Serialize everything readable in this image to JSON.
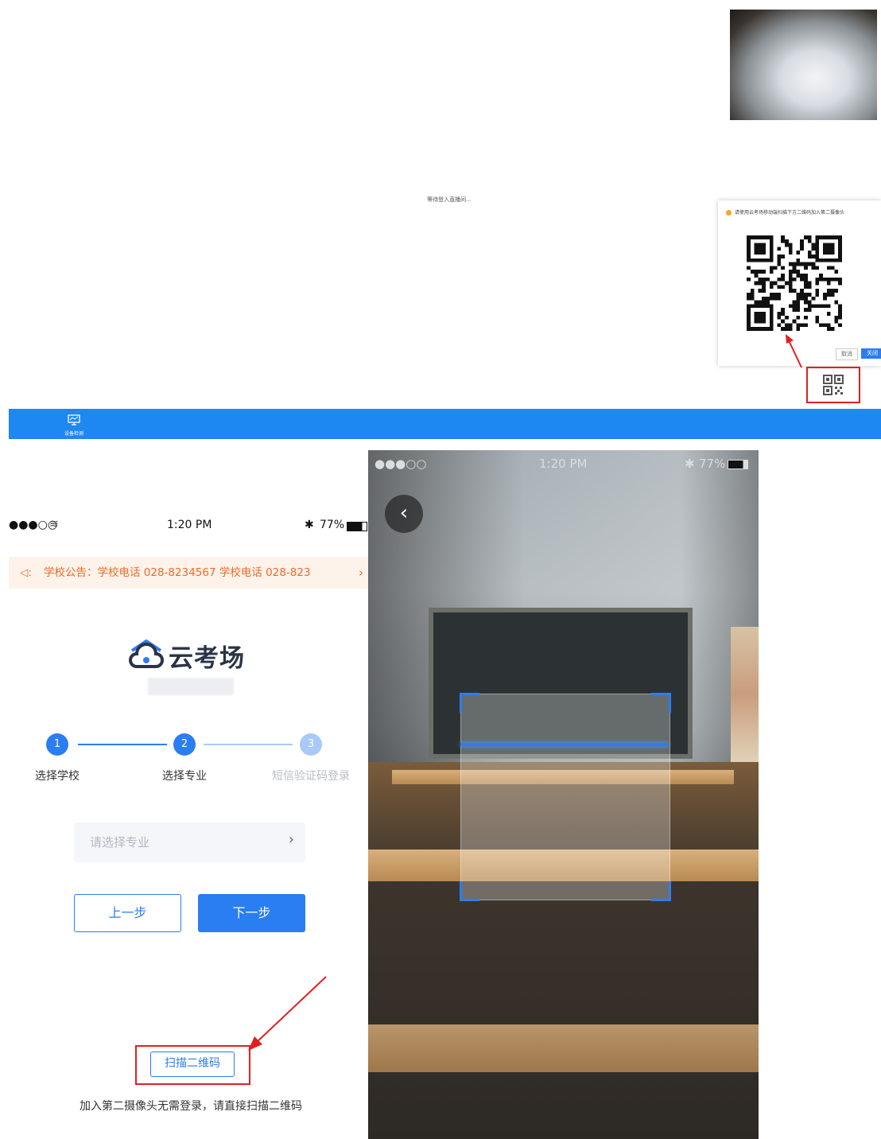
{
  "desktop": {
    "waiting_text": "等待登入直播间...",
    "qr_popup": {
      "tip": "请使用云考场移动端扫描下方二维码加入第二摄像头",
      "cancel_label": "取消",
      "close_label": "关闭"
    },
    "taskbar": {
      "device_check_label": "设备检测"
    }
  },
  "phone_login": {
    "status": {
      "signal": "●●●○○",
      "time": "1:20 PM",
      "battery": "77%"
    },
    "notice": "学校公告：学校电话 028-8234567  学校电话 028-823",
    "brand_name": "云考场",
    "steps": [
      {
        "num": "1",
        "label": "选择学校"
      },
      {
        "num": "2",
        "label": "选择专业"
      },
      {
        "num": "3",
        "label": "短信验证码登录"
      }
    ],
    "major_placeholder": "请选择专业",
    "prev_label": "上一步",
    "next_label": "下一步",
    "scan_label": "扫描二维码",
    "hint": "加入第二摄像头无需登录，请直接扫描二维码"
  },
  "phone_scan": {
    "status": {
      "signal": "●●●○○",
      "time": "1:20 PM",
      "battery": "77%"
    }
  },
  "colors": {
    "accent": "#2b7df2",
    "annotation": "#e02020",
    "notice_text": "#f06a2a"
  }
}
